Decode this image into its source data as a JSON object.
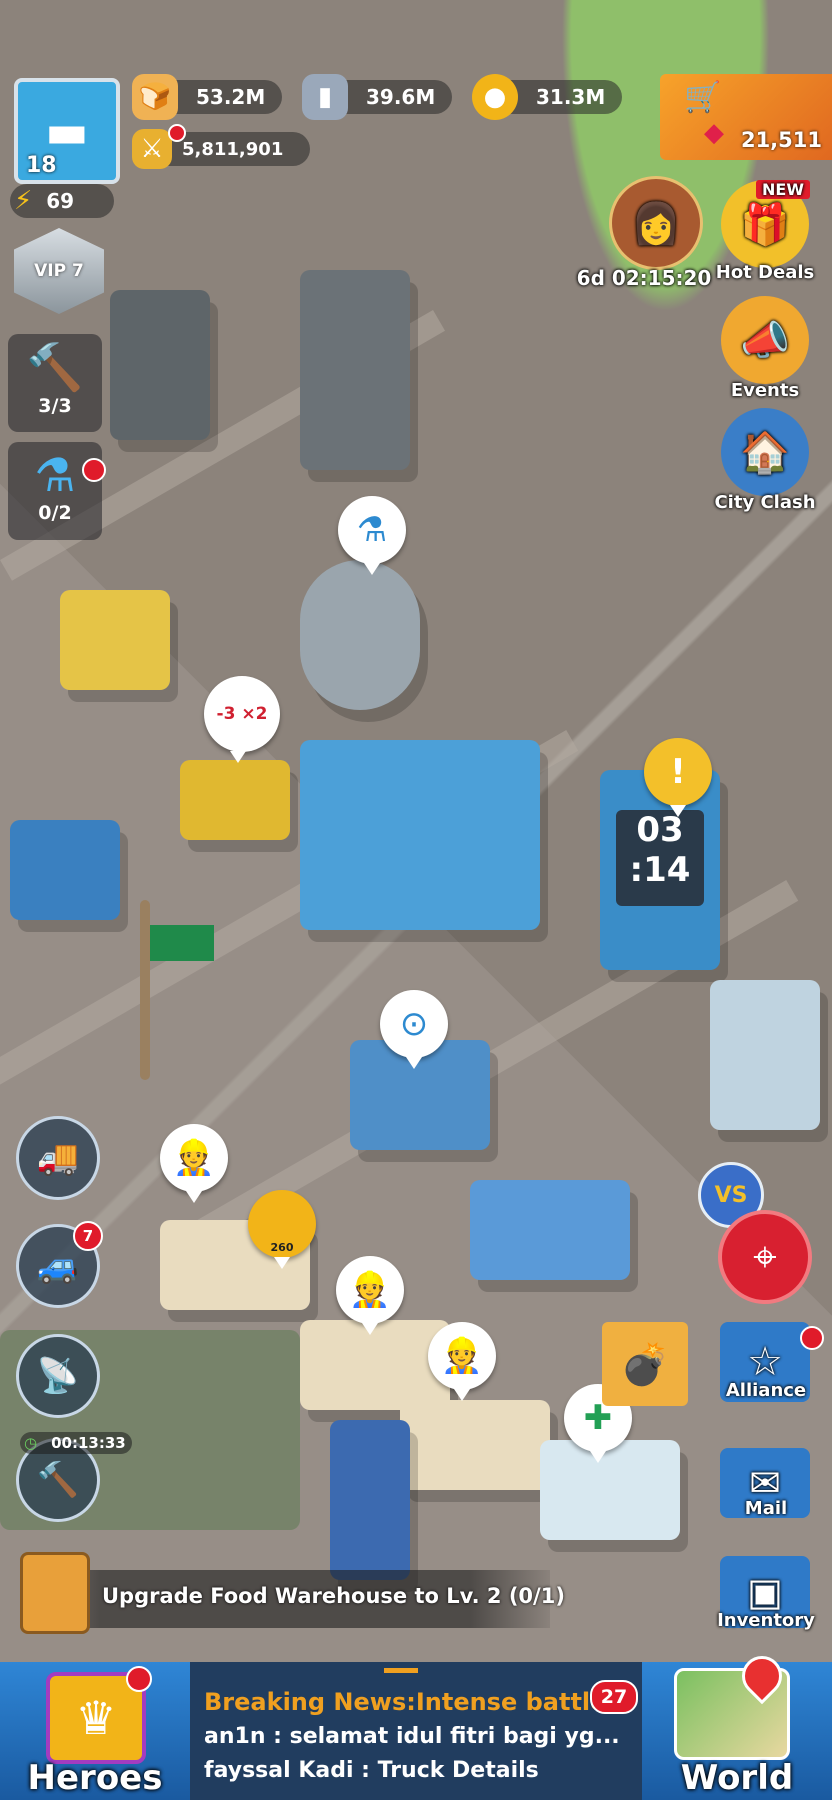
{
  "player": {
    "level": "18",
    "energy": "69",
    "vip": "VIP 7"
  },
  "resources": {
    "food": "53.2M",
    "iron": "39.6M",
    "gold": "31.3M",
    "power": "5,811,901"
  },
  "shop": {
    "gems": "21,511"
  },
  "offer": {
    "timer": "6d 02:15:20",
    "badge": "NEW",
    "hot_deals_label": "Hot Deals"
  },
  "right_menu": {
    "events_label": "Events",
    "city_clash_label": "City Clash",
    "alliance_label": "Alliance",
    "mail_label": "Mail",
    "inventory_label": "Inventory"
  },
  "left_menu": {
    "builders": "3/3",
    "research": "0/2",
    "trucks_badge": "7",
    "build_timer": "00:13:33"
  },
  "city": {
    "countdown_line1": "03",
    "countdown_line2": ":14",
    "boost_label": "-3 ×2",
    "soldier_count": "260",
    "vs_label": "VS"
  },
  "quest": {
    "text": "Upgrade Food Warehouse to Lv. 2 (0/1)"
  },
  "bottom": {
    "heroes_label": "Heroes",
    "world_label": "World",
    "news_headline": "Breaking News:Intense battle ...",
    "chat_badge": "27",
    "chat_line_1": "an1n : selamat idul fitri bagi yg...",
    "chat_line_2": "fayssal Kadi : Truck Details"
  },
  "icons": [
    "tank-icon",
    "energy-icon",
    "bread-icon",
    "iron-icon",
    "coin-icon",
    "power-icon",
    "cart-icon",
    "gem-icon",
    "hammer-icon",
    "flask-icon",
    "truck-icon",
    "satellite-icon",
    "crown-icon",
    "map-icon",
    "star-icon",
    "mail-icon",
    "chest-icon",
    "target-icon",
    "flag-icon"
  ],
  "colors": {
    "accent_blue": "#1f5d9b",
    "gold": "#f2b418",
    "notify_red": "#e01b2a",
    "news_orange": "#f0a020"
  }
}
